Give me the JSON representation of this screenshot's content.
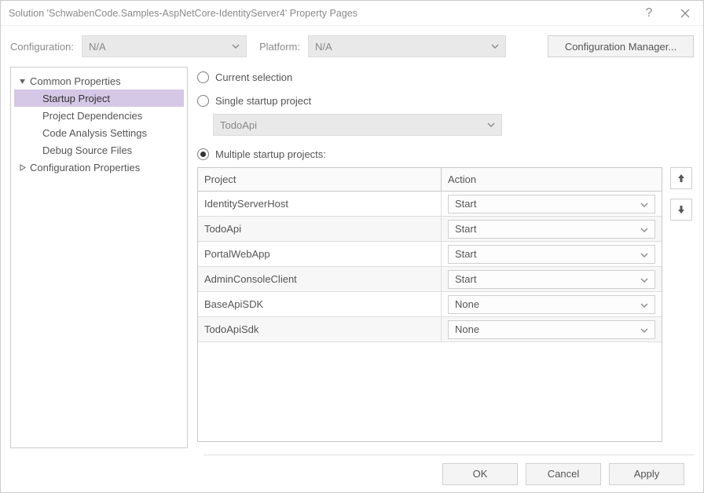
{
  "title": "Solution 'SchwabenCode.Samples-AspNetCore-IdentityServer4' Property Pages",
  "config": {
    "configuration_label": "Configuration:",
    "configuration_value": "N/A",
    "platform_label": "Platform:",
    "platform_value": "N/A",
    "manager_button": "Configuration Manager..."
  },
  "tree": {
    "common": "Common Properties",
    "common_items": {
      "startup": "Startup Project",
      "deps": "Project Dependencies",
      "code_analysis": "Code Analysis Settings",
      "debug_src": "Debug Source Files"
    },
    "config_props": "Configuration Properties"
  },
  "radios": {
    "current_selection": "Current selection",
    "single_startup": "Single startup project",
    "single_startup_value": "TodoApi",
    "multiple_startup": "Multiple startup projects:"
  },
  "table": {
    "header_project": "Project",
    "header_action": "Action",
    "rows": [
      {
        "project": "IdentityServerHost",
        "action": "Start"
      },
      {
        "project": "TodoApi",
        "action": "Start"
      },
      {
        "project": "PortalWebApp",
        "action": "Start"
      },
      {
        "project": "AdminConsoleClient",
        "action": "Start"
      },
      {
        "project": "BaseApiSDK",
        "action": "None"
      },
      {
        "project": "TodoApiSdk",
        "action": "None"
      }
    ]
  },
  "footer": {
    "ok": "OK",
    "cancel": "Cancel",
    "apply": "Apply"
  }
}
